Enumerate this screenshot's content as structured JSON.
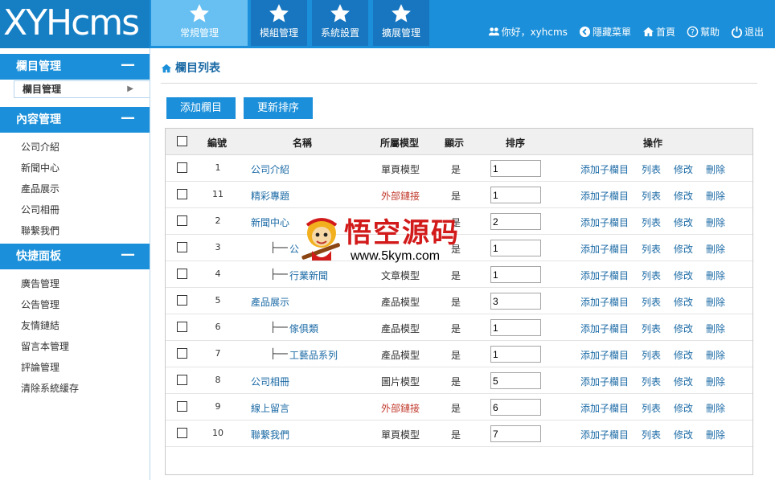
{
  "app": {
    "logo": "XYHcms"
  },
  "nav": {
    "tabs": [
      {
        "label": "常規管理",
        "active": true
      },
      {
        "label": "模組管理"
      },
      {
        "label": "系統設置"
      },
      {
        "label": "擴展管理"
      }
    ]
  },
  "top": {
    "greeting": "你好，xyhcms",
    "hide_menu": "隱藏菜單",
    "home": "首頁",
    "help": "幫助",
    "logout": "退出"
  },
  "sidebar": {
    "sections": [
      {
        "title": "欄目管理",
        "items": [
          {
            "label": "欄目管理",
            "active": true
          }
        ]
      },
      {
        "title": "內容管理",
        "items": [
          {
            "label": "公司介紹"
          },
          {
            "label": "新聞中心"
          },
          {
            "label": "產品展示"
          },
          {
            "label": "公司相冊"
          },
          {
            "label": "聯繫我們"
          }
        ]
      },
      {
        "title": "快捷面板",
        "items": [
          {
            "label": "廣告管理"
          },
          {
            "label": "公告管理"
          },
          {
            "label": "友情鏈結"
          },
          {
            "label": "留言本管理"
          },
          {
            "label": "評論管理"
          },
          {
            "label": "清除系統緩存"
          }
        ]
      }
    ]
  },
  "main": {
    "breadcrumb": "欄目列表",
    "add_button": "添加欄目",
    "sort_button": "更新排序",
    "columns": {
      "id": "編號",
      "name": "名稱",
      "model": "所屬模型",
      "show": "顯示",
      "order": "排序",
      "ops": "操作"
    },
    "ops": {
      "add_child": "添加子欄目",
      "list": "列表",
      "edit": "修改",
      "delete": "刪除"
    },
    "rows": [
      {
        "id": "1",
        "name": "公司介紹",
        "model": "單頁模型",
        "show": "是",
        "order": "1",
        "external": false,
        "child": false
      },
      {
        "id": "11",
        "name": "精彩專題",
        "model": "外部鏈接",
        "show": "是",
        "order": "1",
        "external": true,
        "child": false
      },
      {
        "id": "2",
        "name": "新聞中心",
        "model": "",
        "show": "是",
        "order": "2",
        "external": false,
        "child": false
      },
      {
        "id": "3",
        "name": "公",
        "model": "",
        "show": "是",
        "order": "1",
        "external": false,
        "child": true
      },
      {
        "id": "4",
        "name": "行業新聞",
        "model": "文章模型",
        "show": "是",
        "order": "1",
        "external": false,
        "child": true
      },
      {
        "id": "5",
        "name": "產品展示",
        "model": "產品模型",
        "show": "是",
        "order": "3",
        "external": false,
        "child": false
      },
      {
        "id": "6",
        "name": "傢俱類",
        "model": "產品模型",
        "show": "是",
        "order": "1",
        "external": false,
        "child": true
      },
      {
        "id": "7",
        "name": "工藝品系列",
        "model": "產品模型",
        "show": "是",
        "order": "1",
        "external": false,
        "child": true
      },
      {
        "id": "8",
        "name": "公司相冊",
        "model": "圖片模型",
        "show": "是",
        "order": "5",
        "external": false,
        "child": false
      },
      {
        "id": "9",
        "name": "線上留言",
        "model": "外部鏈接",
        "show": "是",
        "order": "6",
        "external": true,
        "child": false
      },
      {
        "id": "10",
        "name": "聯繫我們",
        "model": "單頁模型",
        "show": "是",
        "order": "7",
        "external": false,
        "child": false
      }
    ]
  },
  "watermark": {
    "title": "悟空源码",
    "url": "www.5kym.com"
  },
  "colors": {
    "primary": "#1b8fd9",
    "active_tab": "#68c0f2",
    "link": "#1b6aa5",
    "external": "#c0392b"
  }
}
